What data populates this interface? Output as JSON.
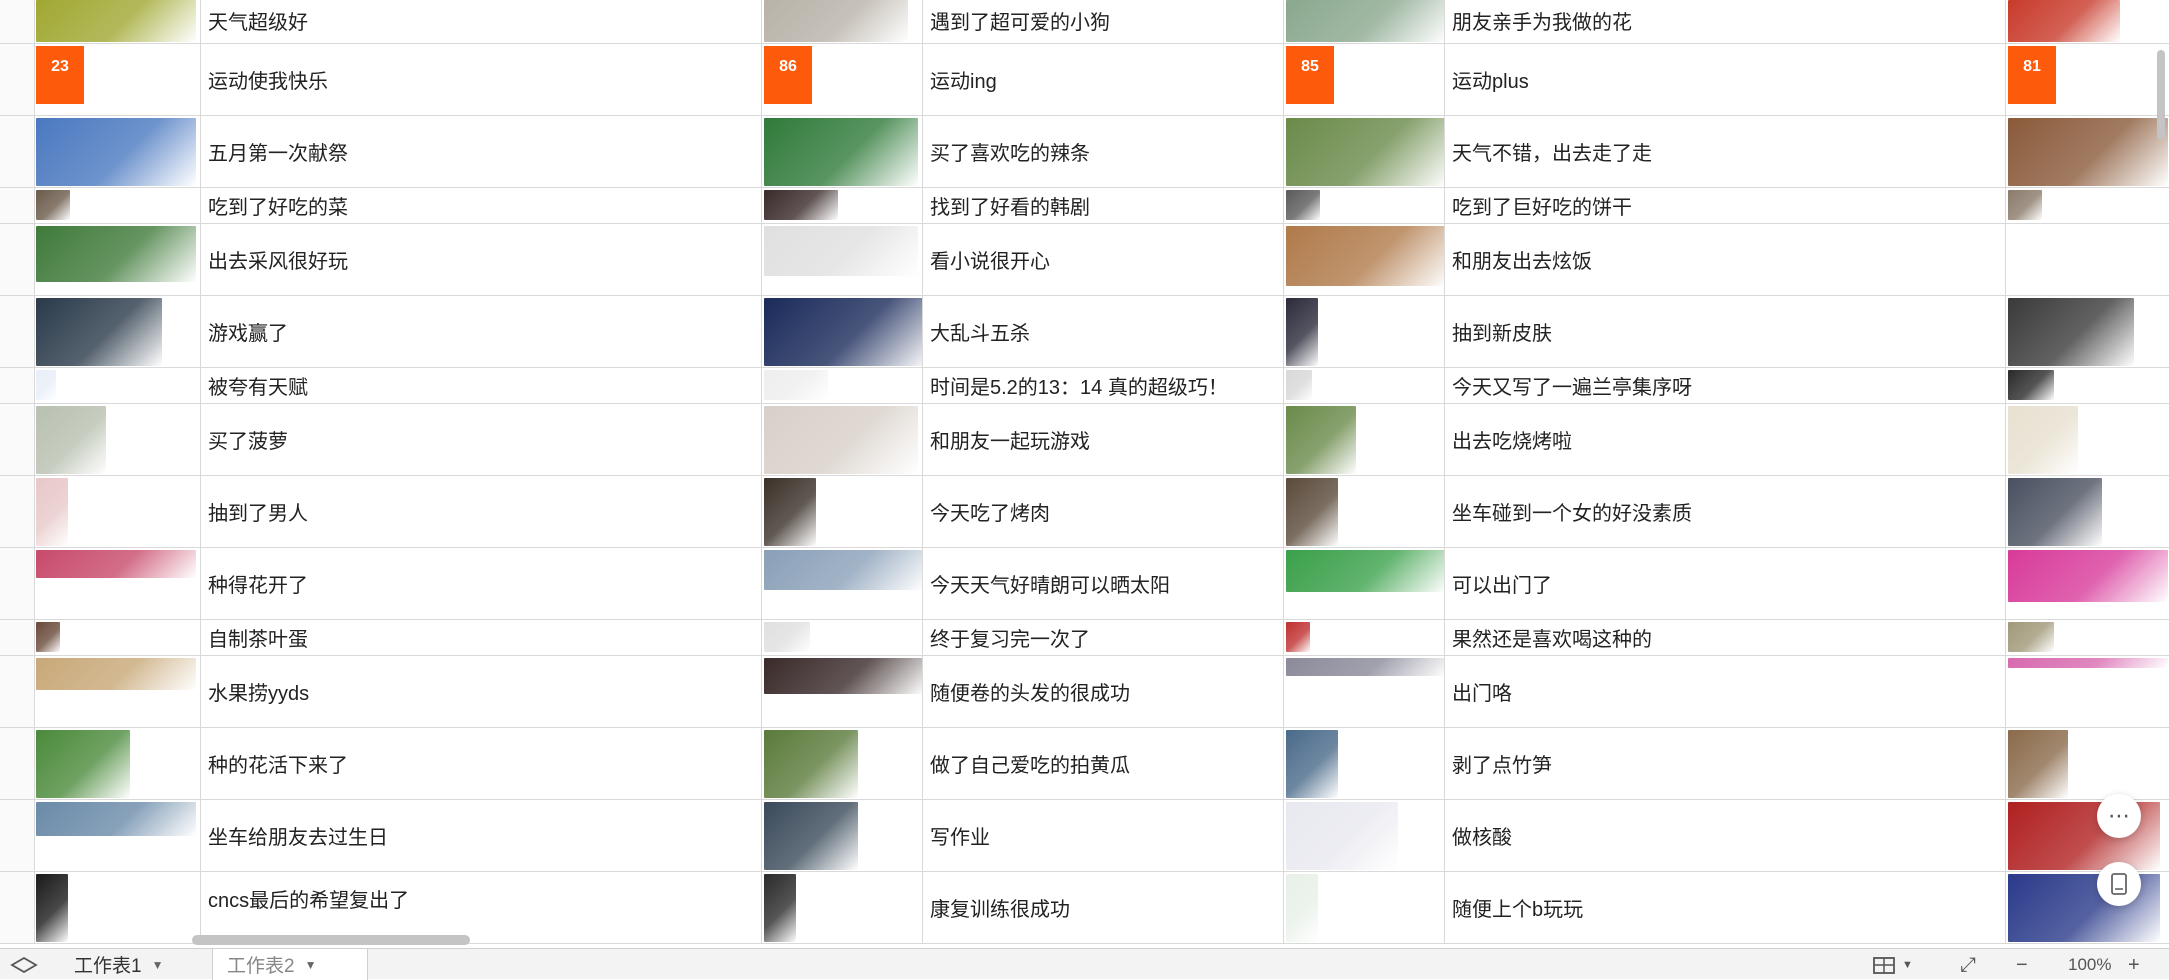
{
  "sheet": {
    "rows": [
      {
        "texts": [
          "天气超级好",
          "遇到了超可爱的小狗",
          "朋友亲手为我做的花"
        ],
        "colors": [
          "#a0a832",
          "#b8b2a8",
          "#8aa88e",
          "#c83a2a"
        ]
      },
      {
        "texts": [
          "运动使我快乐",
          "运动ing",
          "运动plus"
        ],
        "badges": [
          "23",
          "86",
          "85",
          "81"
        ]
      },
      {
        "texts": [
          "五月第一次献祭",
          "买了喜欢吃的辣条",
          "天气不错，出去走了走"
        ],
        "colors": [
          "#4a78c0",
          "#2f7a3a",
          "#6a8a4a",
          "#8a5a3a"
        ]
      },
      {
        "texts": [
          "吃到了好吃的菜",
          "找到了好看的韩剧",
          "吃到了巨好吃的饼干"
        ],
        "colors": [
          "#6a5a4a",
          "#3a2a2a",
          "#5a5a5a",
          "#8a7a6a"
        ]
      },
      {
        "texts": [
          "出去采风很好玩",
          "看小说很开心",
          "和朋友出去炫饭"
        ],
        "colors": [
          "#3f7a3a",
          "#e0e0e0",
          "#b07a4a",
          "#ffffff"
        ]
      },
      {
        "texts": [
          "游戏赢了",
          "大乱斗五杀",
          "抽到新皮肤"
        ],
        "colors": [
          "#2a3a4a",
          "#1a2a5a",
          "#2a2a3a",
          "#3a3a3a"
        ]
      },
      {
        "texts": [
          "被夸有天赋",
          "时间是5.2的13：14 真的超级巧！",
          "今天又写了一遍兰亭集序呀"
        ],
        "colors": [
          "#e8eef8",
          "#eeeeee",
          "#d8d8d8",
          "#2a2a2a"
        ]
      },
      {
        "texts": [
          "买了菠萝",
          "和朋友一起玩游戏",
          "出去吃烧烤啦"
        ],
        "colors": [
          "#b8c0b0",
          "#d8d0c8",
          "#6a8a4a",
          "#e8e0d0"
        ]
      },
      {
        "texts": [
          "抽到了男人",
          "今天吃了烤肉",
          "坐车碰到一个女的好没素质"
        ],
        "colors": [
          "#e8c8c8",
          "#3a3028",
          "#5a4a3a",
          "#4a5060"
        ]
      },
      {
        "texts": [
          "种得花开了",
          "今天天气好晴朗可以晒太阳",
          "可以出门了"
        ],
        "colors": [
          "#c84a6a",
          "#8aa0b8",
          "#3aa04a",
          "#d83a9a"
        ]
      },
      {
        "texts": [
          "自制茶叶蛋",
          "终于复习完一次了",
          "果然还是喜欢喝这种的"
        ],
        "colors": [
          "#6a4a3a",
          "#e0e0e0",
          "#c03030",
          "#a09878"
        ]
      },
      {
        "texts": [
          "水果捞yyds",
          "随便卷的头发的很成功",
          "出门咯"
        ],
        "colors": [
          "#c8a878",
          "#3a2a2a",
          "#8a8a9a",
          "#d86ab0"
        ]
      },
      {
        "texts": [
          "种的花活下来了",
          "做了自己爱吃的拍黄瓜",
          "剥了点竹笋"
        ],
        "colors": [
          "#4a8a3a",
          "#5a7a3a",
          "#4a6a8a",
          "#8a6a4a"
        ]
      },
      {
        "texts": [
          "坐车给朋友去过生日",
          "写作业",
          "做核酸"
        ],
        "colors": [
          "#6a8aa8",
          "#3a4a5a",
          "#e8e8f0",
          "#b02020"
        ]
      },
      {
        "texts": [
          "cncs最后的希望复出了",
          "康复训练很成功",
          "随便上个b玩玩"
        ],
        "colors": [
          "#1a1a1a",
          "#2a2a2a",
          "#e8f0e8",
          "#2a3a8a"
        ]
      }
    ]
  },
  "tabs": {
    "sheet1": "工作表1",
    "sheet2": "工作表2"
  },
  "toolbar": {
    "zoom": "100%"
  }
}
